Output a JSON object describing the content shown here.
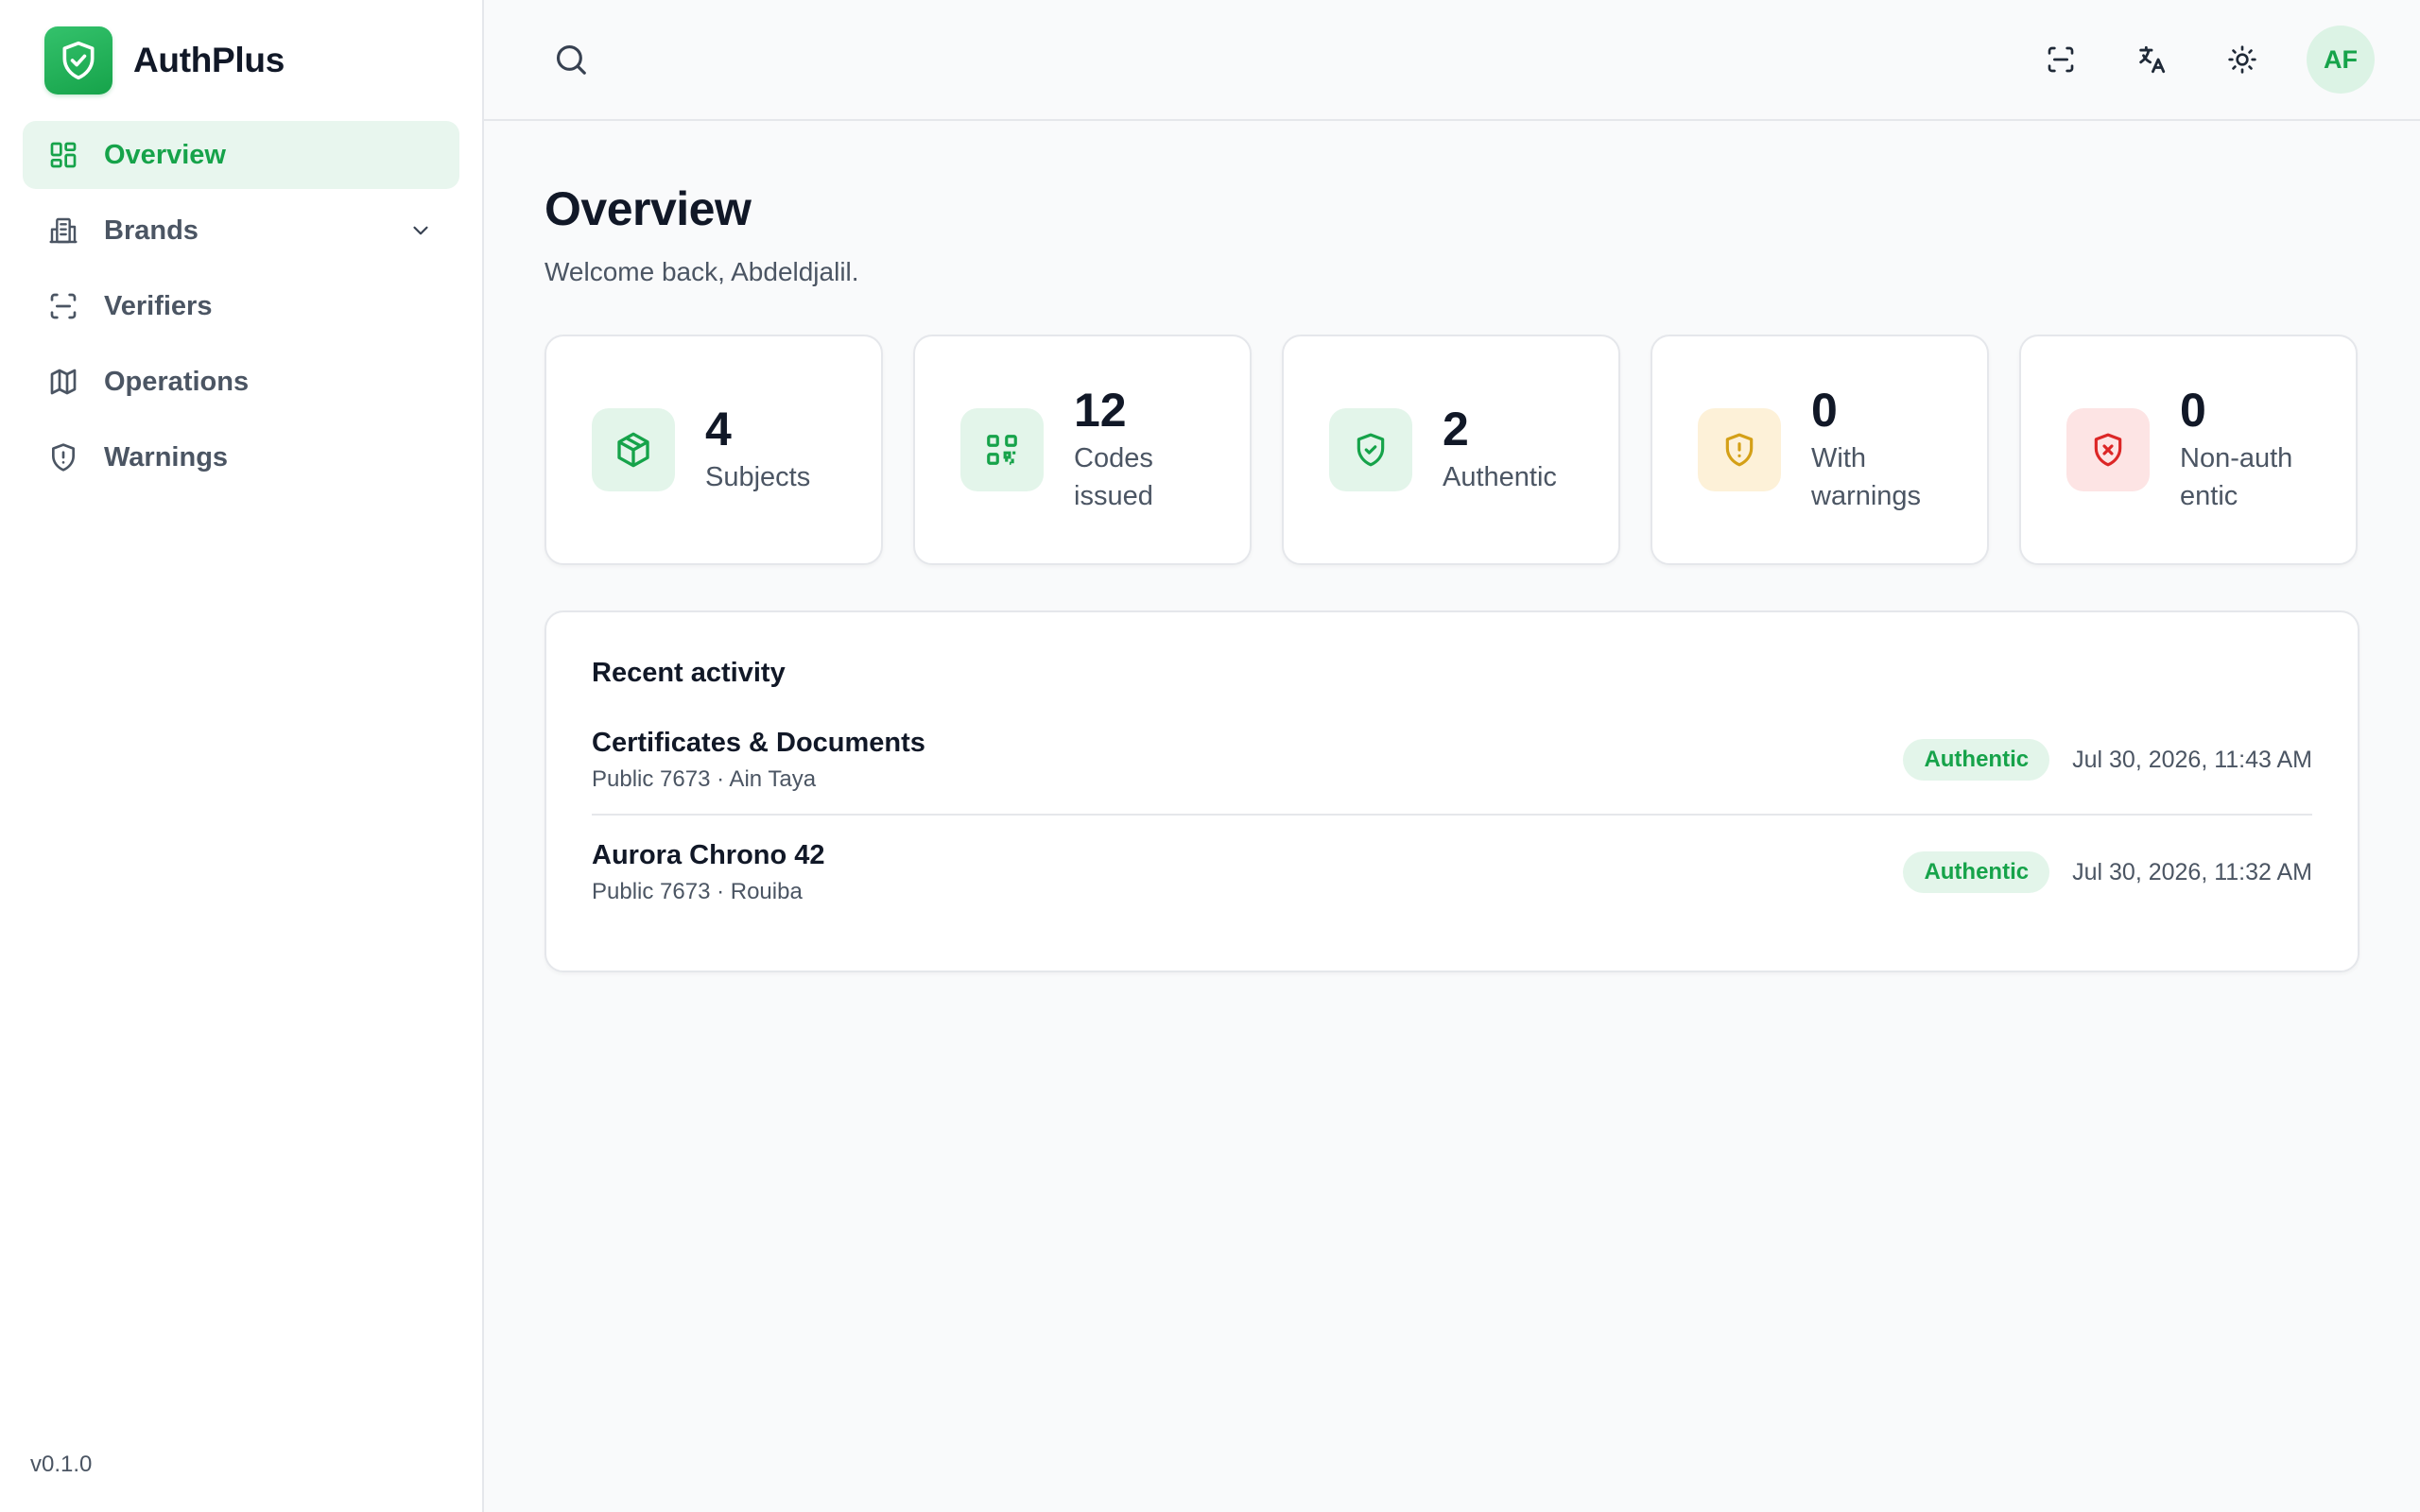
{
  "app": {
    "name": "AuthPlus",
    "version": "v0.1.0"
  },
  "sidebar": {
    "items": [
      {
        "label": "Overview",
        "icon": "dashboard-icon"
      },
      {
        "label": "Brands",
        "icon": "building-icon"
      },
      {
        "label": "Verifiers",
        "icon": "scan-icon"
      },
      {
        "label": "Operations",
        "icon": "map-icon"
      },
      {
        "label": "Warnings",
        "icon": "shield-alert-icon"
      }
    ]
  },
  "topbar": {
    "avatar_initials": "AF"
  },
  "page": {
    "title": "Overview",
    "subtitle": "Welcome back, Abdeldjalil."
  },
  "stats": [
    {
      "value": "4",
      "label": "Subjects",
      "icon": "box-icon",
      "color": "#16a34a"
    },
    {
      "value": "12",
      "label": "Codes issued",
      "icon": "qr-code-icon",
      "color": "#16a34a"
    },
    {
      "value": "2",
      "label": "Authentic",
      "icon": "shield-check-icon",
      "color": "#16a34a"
    },
    {
      "value": "0",
      "label": "With warnings",
      "icon": "shield-alert-icon",
      "color": "#d4a017"
    },
    {
      "value": "0",
      "label": "Non-authentic",
      "icon": "shield-x-icon",
      "color": "#dc2626"
    }
  ],
  "activity": {
    "title": "Recent activity",
    "rows": [
      {
        "title": "Certificates & Documents",
        "sub": "Public 7673 · Ain Taya",
        "status": "Authentic",
        "time": "Jul 30, 2026, 11:43 AM"
      },
      {
        "title": "Aurora Chrono 42",
        "sub": "Public 7673 · Rouiba",
        "status": "Authentic",
        "time": "Jul 30, 2026, 11:32 AM"
      }
    ]
  },
  "colors": {
    "accent": "#16a34a",
    "warning": "#d4a017",
    "danger": "#dc2626"
  }
}
